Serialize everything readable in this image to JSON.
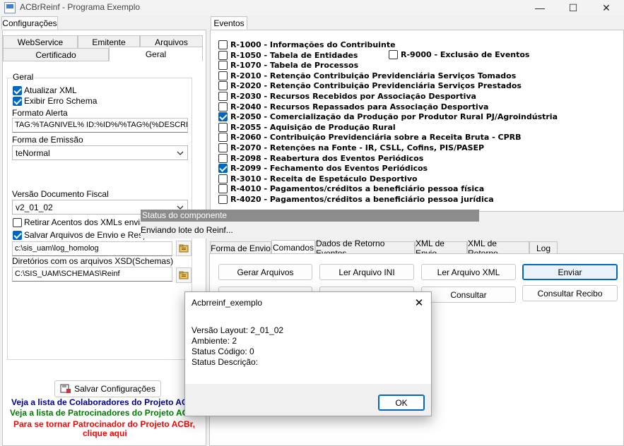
{
  "window": {
    "title": "ACBrReinf - Programa Exemplo",
    "minimize": "—",
    "maximize": "☐",
    "close": "✕"
  },
  "left": {
    "top_tab": "Configurações",
    "tabs_row1": [
      "WebService",
      "Emitente",
      "Arquivos"
    ],
    "tabs_row2": [
      "Certificado",
      "Geral"
    ],
    "group_title": "Geral",
    "chk_atualizar": "Atualizar XML",
    "chk_exibir": "Exibir Erro Schema",
    "formato_alerta_label": "Formato Alerta",
    "formato_alerta_value": "TAG:%TAGNIVEL% ID:%ID%/%TAG%(%DESCRI",
    "forma_emissao_label": "Forma de Emissão",
    "forma_emissao_value": "teNormal",
    "versao_label": "Versão Documento Fiscal",
    "versao_value": "v2_01_02",
    "chk_retirar": "Retirar Acentos dos XMLs enviados",
    "chk_salvar": "Salvar Arquivos de Envio e Resposta",
    "path_log": "c:\\sis_uam\\log_homolog",
    "xsd_label": "Diretórios com os arquivos XSD(Schemas)",
    "path_xsd": "C:\\SIS_UAM\\SCHEMAS\\Reinf",
    "save_button": "Salvar Configurações",
    "link1": "Veja a lista de Colaboradores do Projeto ACBr",
    "link2": "Veja a lista de Patrocinadores do Projeto ACBr",
    "link3": "Para se tornar Patrocinador do Projeto ACBr,",
    "link3b": "clique aqui"
  },
  "events": {
    "tab": "Eventos",
    "items": [
      {
        "label": "R-1000 - Informações do Contribuinte",
        "checked": false
      },
      {
        "label": "R-1050 - Tabela de Entidades",
        "checked": false
      },
      {
        "label": "R-1070 - Tabela de Processos",
        "checked": false
      },
      {
        "label": "R-2010 - Retenção Contribuição Previdenciária  Serviços Tomados",
        "checked": false
      },
      {
        "label": "R-2020 - Retenção Contribuição Previdenciária  Serviços Prestados",
        "checked": false
      },
      {
        "label": "R-2030 - Recursos Recebidos por Associação Desportiva",
        "checked": false
      },
      {
        "label": "R-2040 - Recursos Repassados para Associação Desportiva",
        "checked": false
      },
      {
        "label": "R-2050 - Comercialização da Produção por Produtor Rural PJ/Agroindústria",
        "checked": true
      },
      {
        "label": "R-2055 - Aquisição de Produção Rural",
        "checked": false
      },
      {
        "label": "R-2060 - Contribuição Previdenciária sobre a Receita Bruta - CPRB",
        "checked": false
      },
      {
        "label": "R-2070 - Retenções na Fonte - IR, CSLL, Cofins, PIS/PASEP",
        "checked": false
      },
      {
        "label": "R-2098 - Reabertura dos Eventos Periódicos",
        "checked": false
      },
      {
        "label": "R-2099 - Fechamento dos Eventos Periódicos",
        "checked": true
      },
      {
        "label": "R-3010 - Receita de Espetáculo Desportivo",
        "checked": false
      },
      {
        "label": "R-4010 - Pagamentos/créditos a beneficiário pessoa física",
        "checked": false
      },
      {
        "label": "R-4020 - Pagamentos/créditos a beneficiário pessoa jurídica",
        "checked": false
      }
    ],
    "r9000": "R-9000 - Exclusão de Eventos"
  },
  "status": {
    "title": "Status do componente",
    "message": "Enviando lote do Reinf..."
  },
  "commands": {
    "tabs": [
      "Forma de Envio",
      "Comandos",
      "Dados de Retorno Eventos",
      "XML de Envio",
      "XML de Retorno",
      "Log"
    ],
    "buttons": [
      "Gerar Arquivos",
      "Ler Arquivo INI",
      "Ler Arquivo XML",
      "Enviar",
      "Consultar",
      "Consultar Recibo"
    ]
  },
  "dialog": {
    "title": "Acbrreinf_exemplo",
    "line1": "Versão Layout: 2_01_02",
    "line2": "Ambiente: 2",
    "line3": "Status Código: 0",
    "line4": "Status Descrição:",
    "ok": "OK"
  }
}
